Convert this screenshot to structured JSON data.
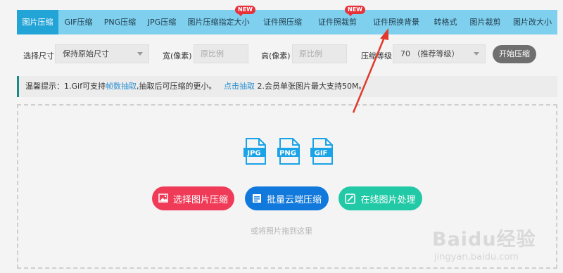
{
  "tabs": [
    {
      "label": "图片压缩",
      "active": true,
      "new": false
    },
    {
      "label": "GIF压缩",
      "active": false,
      "new": false
    },
    {
      "label": "PNG压缩",
      "active": false,
      "new": false
    },
    {
      "label": "JPG压缩",
      "active": false,
      "new": false
    },
    {
      "label": "图片压缩指定大小",
      "active": false,
      "new": true
    },
    {
      "label": "证件照压缩",
      "active": false,
      "new": false
    },
    {
      "label": "证件照裁剪",
      "active": false,
      "new": true
    },
    {
      "label": "证件照换背景",
      "active": false,
      "new": false
    },
    {
      "label": "转格式",
      "active": false,
      "new": false
    },
    {
      "label": "图片裁剪",
      "active": false,
      "new": false
    },
    {
      "label": "图片改大小",
      "active": false,
      "new": false
    }
  ],
  "badge_text": "NEW",
  "options": {
    "size_label": "选择尺寸",
    "size_value": "保持原始尺寸",
    "width_label": "宽(像素)",
    "width_placeholder": "原比例",
    "height_label": "高(像素)",
    "height_placeholder": "原比例",
    "level_label": "压缩等级",
    "level_value": "70 （推荐等级）",
    "start_label": "开始压缩"
  },
  "tip": {
    "prefix": "温馨提示：1.Gif可支持",
    "link1": "帧数抽取",
    "middle": ",抽取后可压缩的更小。",
    "link2": "点击抽取",
    "suffix": " 2.会员单张图片最大支持50M。"
  },
  "file_icons": [
    "JPG",
    "PNG",
    "GIF"
  ],
  "buttons": {
    "select": "选择图片压缩",
    "batch": "批量云端压缩",
    "online": "在线图片处理"
  },
  "drop_hint": "或将照片拖到这里",
  "watermark": {
    "logo": "Baidu经验",
    "url": "jingyan.baidu.com"
  },
  "colors": {
    "tab_bar": "#7fd0ee",
    "tab_active": "#22a4d6",
    "badge": "#e8323a",
    "btn_red": "#ef3b57",
    "btn_blue": "#1178dc",
    "btn_green": "#22c9a6",
    "tip_accent": "#1a8a86",
    "link": "#2a8fd0",
    "file_icon": "#1aa3e6",
    "annotation_arrow": "#e0392b"
  }
}
